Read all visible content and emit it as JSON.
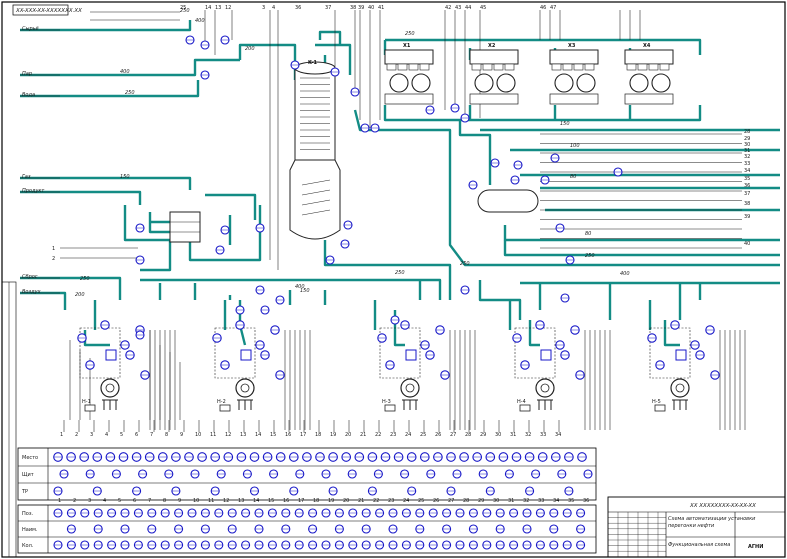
{
  "colors": {
    "pipe": "#138c85",
    "signal": "#1a1a1a",
    "instrument_fill": "#ffffff",
    "instrument_stroke": "#1818c8",
    "device": "#222222",
    "frame": "#000000"
  },
  "drawing_code": "XX-XXX-XX-XXXXXXX.XX",
  "flow_values": [
    "250",
    "400",
    "250",
    "200",
    "400",
    "150",
    "250",
    "200",
    "250",
    "400",
    "150",
    "250",
    "250",
    "400",
    "150",
    "100",
    "80",
    "80",
    "250"
  ],
  "column": {
    "name": "K-1"
  },
  "collector_labels": [
    "X1",
    "X2",
    "X3",
    "X4"
  ],
  "pump_labels": [
    "H-1",
    "H-2",
    "H-3",
    "H-4",
    "H-5"
  ],
  "left_labels": [
    "Сырьё",
    "Пар",
    "Вода",
    "Газ",
    "Продукт",
    "Сброс",
    "Воздух"
  ],
  "left_numbers": [
    "1",
    "2"
  ],
  "right_numbers": [
    "28",
    "29",
    "30",
    "31",
    "32",
    "33",
    "34",
    "35",
    "36",
    "37",
    "38",
    "39",
    "40"
  ],
  "top_numbers": [
    "25",
    "14",
    "13",
    "12",
    "3",
    "4",
    "36",
    "37",
    "38",
    "39",
    "40",
    "41",
    "42",
    "43",
    "44",
    "45",
    "46",
    "47"
  ],
  "instrument_table": {
    "row_labels": [
      "Место",
      "Щит",
      "ТР"
    ],
    "column_count": 41,
    "bottom_row_labels": [
      "Поз.",
      "Наим.",
      "Кол."
    ]
  },
  "title_block": {
    "code": "XX XXXXXXXX-XX-XX-XX",
    "title": "Схема автоматизации установки",
    "subtitle": "перегонки нефти",
    "sheet_name": "Функциональная схема",
    "org": "АГНИ"
  }
}
